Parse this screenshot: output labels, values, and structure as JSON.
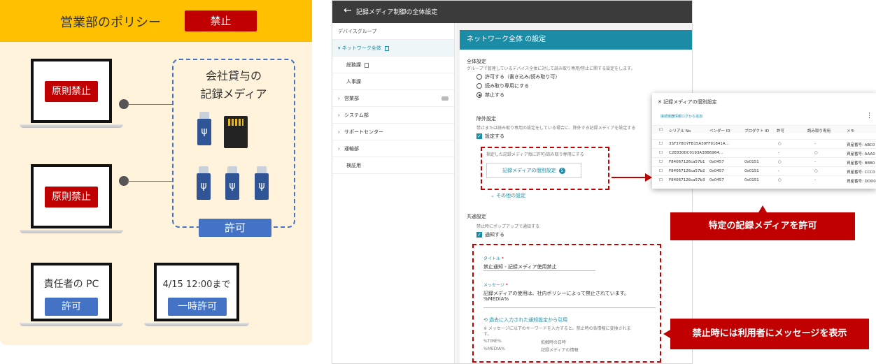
{
  "policy": {
    "title": "営業部のポリシー",
    "ban_badge": "禁止",
    "laptop1_badge": "原則禁止",
    "laptop2_badge": "原則禁止",
    "media_title_line1": "会社貸与の",
    "media_title_line2": "記録メディア",
    "allow_badge": "許可",
    "manager_pc_label": "責任者の PC",
    "manager_pc_badge": "許可",
    "temp_label": "4/15 12:00まで",
    "temp_badge": "一時許可",
    "usb_glyph": "ψ"
  },
  "app": {
    "back_icon": "←",
    "title": "記録メディア制御の全体設定",
    "sidebar": {
      "header": "デバイスグループ",
      "items": [
        {
          "label": "ネットワーク全体",
          "prefix": "▾"
        },
        {
          "label": "総務課",
          "prefix": ""
        },
        {
          "label": "人事課",
          "prefix": ""
        },
        {
          "label": "営業部",
          "prefix": "›"
        },
        {
          "label": "システム部",
          "prefix": "›"
        },
        {
          "label": "サポートセンター",
          "prefix": "›"
        },
        {
          "label": "運輸部",
          "prefix": "›"
        },
        {
          "label": "検証用",
          "prefix": ""
        }
      ]
    },
    "card_title": "ネットワーク全体 の設定",
    "overall": {
      "heading": "全体設定",
      "desc": "グループで管理しているデバイス全体に対して読み取り専用/禁止に関する設定をします。",
      "options": [
        "許可する（書き込み/読み取り可）",
        "読み取り専用にする",
        "禁止する"
      ],
      "selected": 2
    },
    "exclusion": {
      "heading": "除外設定",
      "desc": "禁止または読み取り専用の設定をしている場合に、除外する記録メディアを設定する",
      "checkbox": "設定する",
      "note": "指定した記録メディア毎に許可/読み取り専用にする",
      "button": "記録メディアの個別設定",
      "button_count": "5",
      "more": "その他の設定"
    },
    "common": {
      "heading": "共通設定",
      "desc": "禁止時にポップアップで通知する",
      "checkbox": "通知する",
      "title_label": "タイトル",
      "title_value": "禁止通知 - 記録メディア使用禁止",
      "msg_label": "メッセージ",
      "msg_line1": "記録メディアの使用は、社内ポリシーによって禁止されています。",
      "msg_line2": "%MEDIA%",
      "history_link": "過去に入力された通知設定から引用",
      "hint_line1": "※ メッセージに以下のキーワードを入力すると、禁止時の各情報に変換されま",
      "hint_line2": "す。",
      "kw1": "%TIME%",
      "kw1_desc": "抵触時の日時",
      "kw2": "%MEDIA%",
      "kw2_desc": "記録メディアの情報"
    }
  },
  "popup": {
    "title": "記録メディアの個別設定",
    "link": "接続機器情報ログから追加",
    "columns": [
      "シリアル No",
      "ベンダー ID",
      "プロダクト ID",
      "許可",
      "読み取り専用",
      "メモ"
    ],
    "rows": [
      [
        "3SF378D7FB15A39FF91841A...",
        "",
        "",
        "○",
        "-",
        "資産番号: ABC0"
      ],
      [
        "C2E830DC0193A38B6964...",
        "",
        "",
        "-",
        "○",
        "資産番号: AAA0"
      ],
      [
        "F84067126ca57b1",
        "0x0457",
        "0x0151",
        "○",
        "-",
        "資産番号: BBB0"
      ],
      [
        "F84067126ca57b2",
        "0x0457",
        "0x0151",
        "-",
        "○",
        "資産番号: CCC0"
      ],
      [
        "F84067126ca57b3",
        "0x0457",
        "0x0151",
        "○",
        "-",
        "資産番号: DDD0"
      ]
    ]
  },
  "callouts": {
    "allow_specific": "特定の記録メディアを許可",
    "show_message": "禁止時には利用者にメッセージを表示"
  },
  "colors": {
    "policy_header": "#ffc000",
    "policy_bg": "#fff3db",
    "ban_red": "#c00000",
    "allow_blue": "#4472c4",
    "teal": "#1b8ca6"
  }
}
